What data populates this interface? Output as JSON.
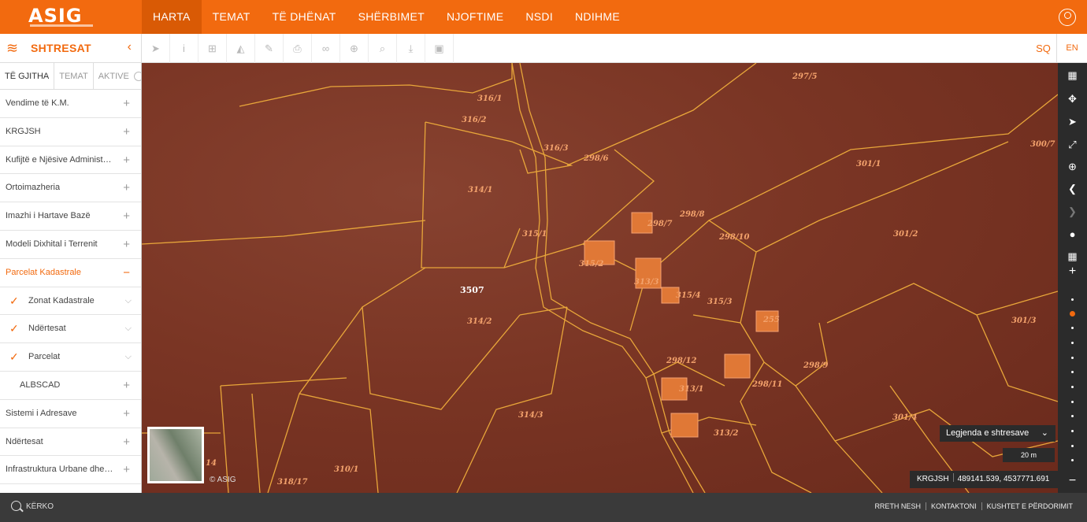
{
  "header": {
    "logo": "ASIG",
    "nav": [
      "HARTA",
      "TEMAT",
      "TË DHËNAT",
      "SHËRBIMET",
      "NJOFTIME",
      "NSDI",
      "NDIHME"
    ],
    "active_nav": "HARTA",
    "user_icon": "user-circle-icon"
  },
  "toolbar": {
    "panel_title": "SHTRESAT",
    "tools": [
      "pointer-icon",
      "info-icon",
      "add-icon",
      "profile-icon",
      "edit-icon",
      "print-icon",
      "link-icon",
      "locate-icon",
      "search-icon",
      "download-icon",
      "image-icon"
    ],
    "lang_sq": "SQ",
    "lang_en": "EN"
  },
  "sidebar": {
    "tabs": [
      "TË GJITHA",
      "TEMAT",
      "AKTIVE"
    ],
    "layers": [
      {
        "label": "Vendime të K.M.",
        "state": "+"
      },
      {
        "label": "KRGJSH",
        "state": "+"
      },
      {
        "label": "Kufijtë e Njësive Administra...",
        "state": "+"
      },
      {
        "label": "Ortoimazheria",
        "state": "+"
      },
      {
        "label": "Imazhi i Hartave Bazë",
        "state": "+"
      },
      {
        "label": "Modeli Dixhital i Terrenit",
        "state": "+"
      },
      {
        "label": "Parcelat Kadastrale",
        "state": "−"
      },
      {
        "label": "Zonat Kadastrale",
        "state": "⌵"
      },
      {
        "label": "Ndërtesat",
        "state": "⌵"
      },
      {
        "label": "Parcelat",
        "state": "⌵"
      },
      {
        "label": "ALBSCAD",
        "state": "+"
      },
      {
        "label": "Sistemi i Adresave",
        "state": "+"
      },
      {
        "label": "Ndërtesat",
        "state": "+"
      },
      {
        "label": "Infrastruktura Urbane dhe S...",
        "state": "+"
      }
    ]
  },
  "map": {
    "parcels": [
      "297/5",
      "316/1",
      "316/2",
      "316/3",
      "298/6",
      "300/7",
      "301/1",
      "314/1",
      "298/7",
      "298/8",
      "298/10",
      "315/1",
      "315/2",
      "313/3",
      "315/4",
      "315/3",
      "301/2",
      "3507",
      "314/2",
      "255",
      "301/3",
      "298/12",
      "298/9",
      "298/11",
      "313/1",
      "314/3",
      "313/2",
      "301/4",
      "14",
      "318/17",
      "310/1"
    ],
    "copyright": "© ASIG",
    "legend_button": "Legjenda e shtresave",
    "scale": "20 m",
    "crs": "KRGJSH",
    "coordinates": "489141.539, 4537771.691"
  },
  "footer": {
    "search_label": "KËRKO",
    "links": [
      "RRETH NESH",
      "KONTAKTONI",
      "KUSHTET E PËRDORIMIT"
    ]
  },
  "colors": {
    "brand_orange": "#f26a0f",
    "panel_dark": "#2b2b2b",
    "parcel_line": "#e8a63a"
  }
}
